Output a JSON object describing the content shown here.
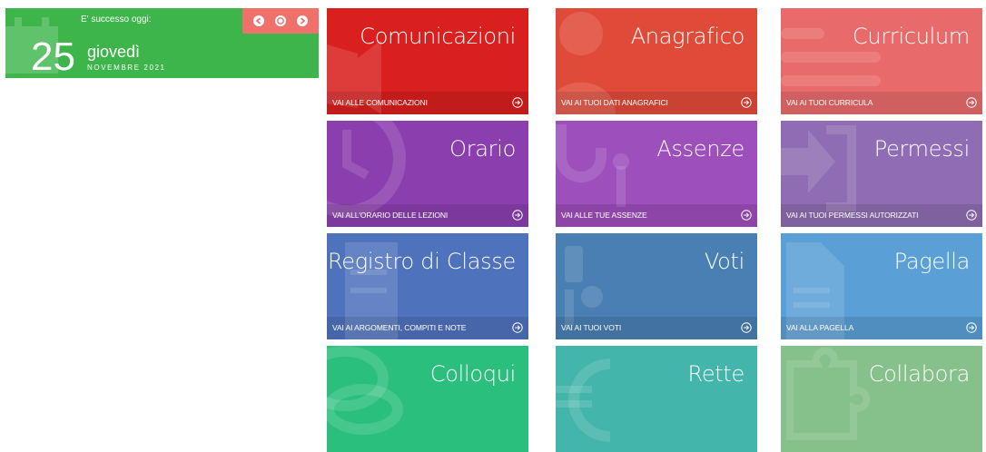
{
  "date_widget": {
    "event_label": "E' successo oggi:",
    "day": "25",
    "weekday": "giovedì",
    "month_year": "NOVEMBRE 2021",
    "color": "#3db54a",
    "nav_color": "#f0706b"
  },
  "tiles": [
    {
      "title": "Comunicazioni",
      "link": "VAI ALLE COMUNICAZIONI",
      "color": "#d9201e",
      "icon": "megaphone-icon"
    },
    {
      "title": "Anagrafico",
      "link": "VAI AI TUOI DATI ANAGRAFICI",
      "color": "#e04a39",
      "icon": "user-icon"
    },
    {
      "title": "Curriculum",
      "link": "VAI AI TUOI CURRICULA",
      "color": "#e86a6a",
      "icon": "list-icon"
    },
    {
      "title": "Orario",
      "link": "VAI ALL'ORARIO DELLE LEZIONI",
      "color": "#8b3fae",
      "icon": "clock-icon"
    },
    {
      "title": "Assenze",
      "link": "VAI ALLE TUE ASSENZE",
      "color": "#9d4fbc",
      "icon": "key-icon"
    },
    {
      "title": "Permessi",
      "link": "VAI AI TUOI PERMESSI AUTORIZZATI",
      "color": "#8f6cb3",
      "icon": "exit-icon"
    },
    {
      "title": "Registro di Classe",
      "link": "VAI AI ARGOMENTI, COMPITI E NOTE",
      "color": "#4f72bd",
      "icon": "register-icon"
    },
    {
      "title": "Voti",
      "link": "VAI AI TUOI VOTI",
      "color": "#4a7fb3",
      "icon": "grades-icon"
    },
    {
      "title": "Pagella",
      "link": "VAI ALLA PAGELLA",
      "color": "#5a9fd6",
      "icon": "document-icon"
    },
    {
      "title": "Colloqui",
      "link": "",
      "color": "#2bbf7e",
      "icon": "chat-icon"
    },
    {
      "title": "Rette",
      "link": "",
      "color": "#43b5aa",
      "icon": "euro-icon"
    },
    {
      "title": "Collabora",
      "link": "",
      "color": "#86c08a",
      "icon": "puzzle-icon"
    }
  ]
}
